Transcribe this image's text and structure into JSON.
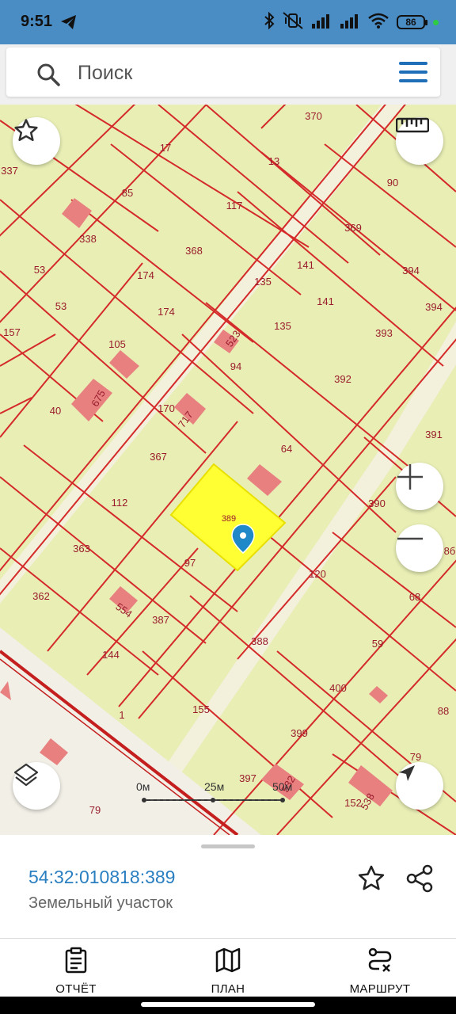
{
  "status_bar": {
    "time": "9:51",
    "battery": "86",
    "icons": [
      "telegram-icon",
      "bluetooth-icon",
      "vibrate-off-icon",
      "signal-icon",
      "signal-icon",
      "wifi-icon",
      "battery-icon"
    ]
  },
  "search": {
    "placeholder": "Поиск"
  },
  "map": {
    "parcel_labels": [
      "370",
      "337",
      "17",
      "13",
      "90",
      "85",
      "117",
      "338",
      "369",
      "53",
      "174",
      "368",
      "141",
      "135",
      "394",
      "53",
      "141",
      "394",
      "157",
      "174",
      "105",
      "135",
      "523",
      "393",
      "94",
      "392",
      "675",
      "40",
      "170",
      "717",
      "391",
      "64",
      "367",
      "112",
      "389",
      "390",
      "363",
      "97",
      "120",
      "362",
      "554",
      "387",
      "68",
      "144",
      "388",
      "59",
      "400",
      "155",
      "88",
      "1",
      "399",
      "397",
      "79",
      "79",
      "532",
      "152",
      "538",
      "8б"
    ],
    "scale_labels": [
      "0м",
      "25м",
      "50м"
    ],
    "selected_parcel_color": "#ffff33"
  },
  "selection": {
    "cadastral_number": "54:32:010818:389",
    "object_type": "Земельный участок"
  },
  "bottom_nav": {
    "report_label": "ОТЧЁТ",
    "plan_label": "ПЛАН",
    "route_label": "МАРШРУТ"
  },
  "colors": {
    "status_bar": "#4a8cc4",
    "map_background": "#e8eeb4",
    "parcel_border": "#d42a2a",
    "building": "#e88080",
    "accent": "#2a7fc1"
  }
}
